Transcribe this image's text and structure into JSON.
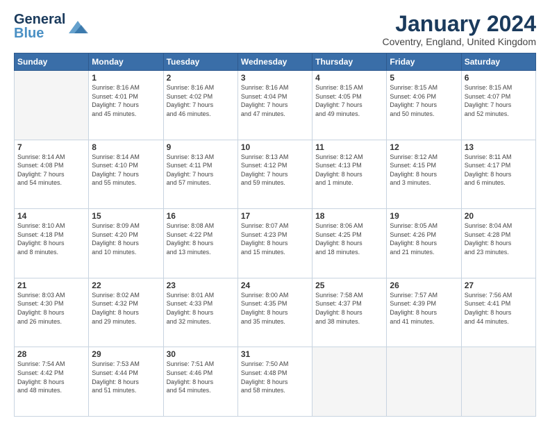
{
  "header": {
    "logo_general": "General",
    "logo_blue": "Blue",
    "month_title": "January 2024",
    "location": "Coventry, England, United Kingdom"
  },
  "days_of_week": [
    "Sunday",
    "Monday",
    "Tuesday",
    "Wednesday",
    "Thursday",
    "Friday",
    "Saturday"
  ],
  "weeks": [
    [
      {
        "day": "",
        "info": ""
      },
      {
        "day": "1",
        "info": "Sunrise: 8:16 AM\nSunset: 4:01 PM\nDaylight: 7 hours\nand 45 minutes."
      },
      {
        "day": "2",
        "info": "Sunrise: 8:16 AM\nSunset: 4:02 PM\nDaylight: 7 hours\nand 46 minutes."
      },
      {
        "day": "3",
        "info": "Sunrise: 8:16 AM\nSunset: 4:04 PM\nDaylight: 7 hours\nand 47 minutes."
      },
      {
        "day": "4",
        "info": "Sunrise: 8:15 AM\nSunset: 4:05 PM\nDaylight: 7 hours\nand 49 minutes."
      },
      {
        "day": "5",
        "info": "Sunrise: 8:15 AM\nSunset: 4:06 PM\nDaylight: 7 hours\nand 50 minutes."
      },
      {
        "day": "6",
        "info": "Sunrise: 8:15 AM\nSunset: 4:07 PM\nDaylight: 7 hours\nand 52 minutes."
      }
    ],
    [
      {
        "day": "7",
        "info": "Sunrise: 8:14 AM\nSunset: 4:08 PM\nDaylight: 7 hours\nand 54 minutes."
      },
      {
        "day": "8",
        "info": "Sunrise: 8:14 AM\nSunset: 4:10 PM\nDaylight: 7 hours\nand 55 minutes."
      },
      {
        "day": "9",
        "info": "Sunrise: 8:13 AM\nSunset: 4:11 PM\nDaylight: 7 hours\nand 57 minutes."
      },
      {
        "day": "10",
        "info": "Sunrise: 8:13 AM\nSunset: 4:12 PM\nDaylight: 7 hours\nand 59 minutes."
      },
      {
        "day": "11",
        "info": "Sunrise: 8:12 AM\nSunset: 4:13 PM\nDaylight: 8 hours\nand 1 minute."
      },
      {
        "day": "12",
        "info": "Sunrise: 8:12 AM\nSunset: 4:15 PM\nDaylight: 8 hours\nand 3 minutes."
      },
      {
        "day": "13",
        "info": "Sunrise: 8:11 AM\nSunset: 4:17 PM\nDaylight: 8 hours\nand 6 minutes."
      }
    ],
    [
      {
        "day": "14",
        "info": "Sunrise: 8:10 AM\nSunset: 4:18 PM\nDaylight: 8 hours\nand 8 minutes."
      },
      {
        "day": "15",
        "info": "Sunrise: 8:09 AM\nSunset: 4:20 PM\nDaylight: 8 hours\nand 10 minutes."
      },
      {
        "day": "16",
        "info": "Sunrise: 8:08 AM\nSunset: 4:22 PM\nDaylight: 8 hours\nand 13 minutes."
      },
      {
        "day": "17",
        "info": "Sunrise: 8:07 AM\nSunset: 4:23 PM\nDaylight: 8 hours\nand 15 minutes."
      },
      {
        "day": "18",
        "info": "Sunrise: 8:06 AM\nSunset: 4:25 PM\nDaylight: 8 hours\nand 18 minutes."
      },
      {
        "day": "19",
        "info": "Sunrise: 8:05 AM\nSunset: 4:26 PM\nDaylight: 8 hours\nand 21 minutes."
      },
      {
        "day": "20",
        "info": "Sunrise: 8:04 AM\nSunset: 4:28 PM\nDaylight: 8 hours\nand 23 minutes."
      }
    ],
    [
      {
        "day": "21",
        "info": "Sunrise: 8:03 AM\nSunset: 4:30 PM\nDaylight: 8 hours\nand 26 minutes."
      },
      {
        "day": "22",
        "info": "Sunrise: 8:02 AM\nSunset: 4:32 PM\nDaylight: 8 hours\nand 29 minutes."
      },
      {
        "day": "23",
        "info": "Sunrise: 8:01 AM\nSunset: 4:33 PM\nDaylight: 8 hours\nand 32 minutes."
      },
      {
        "day": "24",
        "info": "Sunrise: 8:00 AM\nSunset: 4:35 PM\nDaylight: 8 hours\nand 35 minutes."
      },
      {
        "day": "25",
        "info": "Sunrise: 7:58 AM\nSunset: 4:37 PM\nDaylight: 8 hours\nand 38 minutes."
      },
      {
        "day": "26",
        "info": "Sunrise: 7:57 AM\nSunset: 4:39 PM\nDaylight: 8 hours\nand 41 minutes."
      },
      {
        "day": "27",
        "info": "Sunrise: 7:56 AM\nSunset: 4:41 PM\nDaylight: 8 hours\nand 44 minutes."
      }
    ],
    [
      {
        "day": "28",
        "info": "Sunrise: 7:54 AM\nSunset: 4:42 PM\nDaylight: 8 hours\nand 48 minutes."
      },
      {
        "day": "29",
        "info": "Sunrise: 7:53 AM\nSunset: 4:44 PM\nDaylight: 8 hours\nand 51 minutes."
      },
      {
        "day": "30",
        "info": "Sunrise: 7:51 AM\nSunset: 4:46 PM\nDaylight: 8 hours\nand 54 minutes."
      },
      {
        "day": "31",
        "info": "Sunrise: 7:50 AM\nSunset: 4:48 PM\nDaylight: 8 hours\nand 58 minutes."
      },
      {
        "day": "",
        "info": ""
      },
      {
        "day": "",
        "info": ""
      },
      {
        "day": "",
        "info": ""
      }
    ]
  ]
}
